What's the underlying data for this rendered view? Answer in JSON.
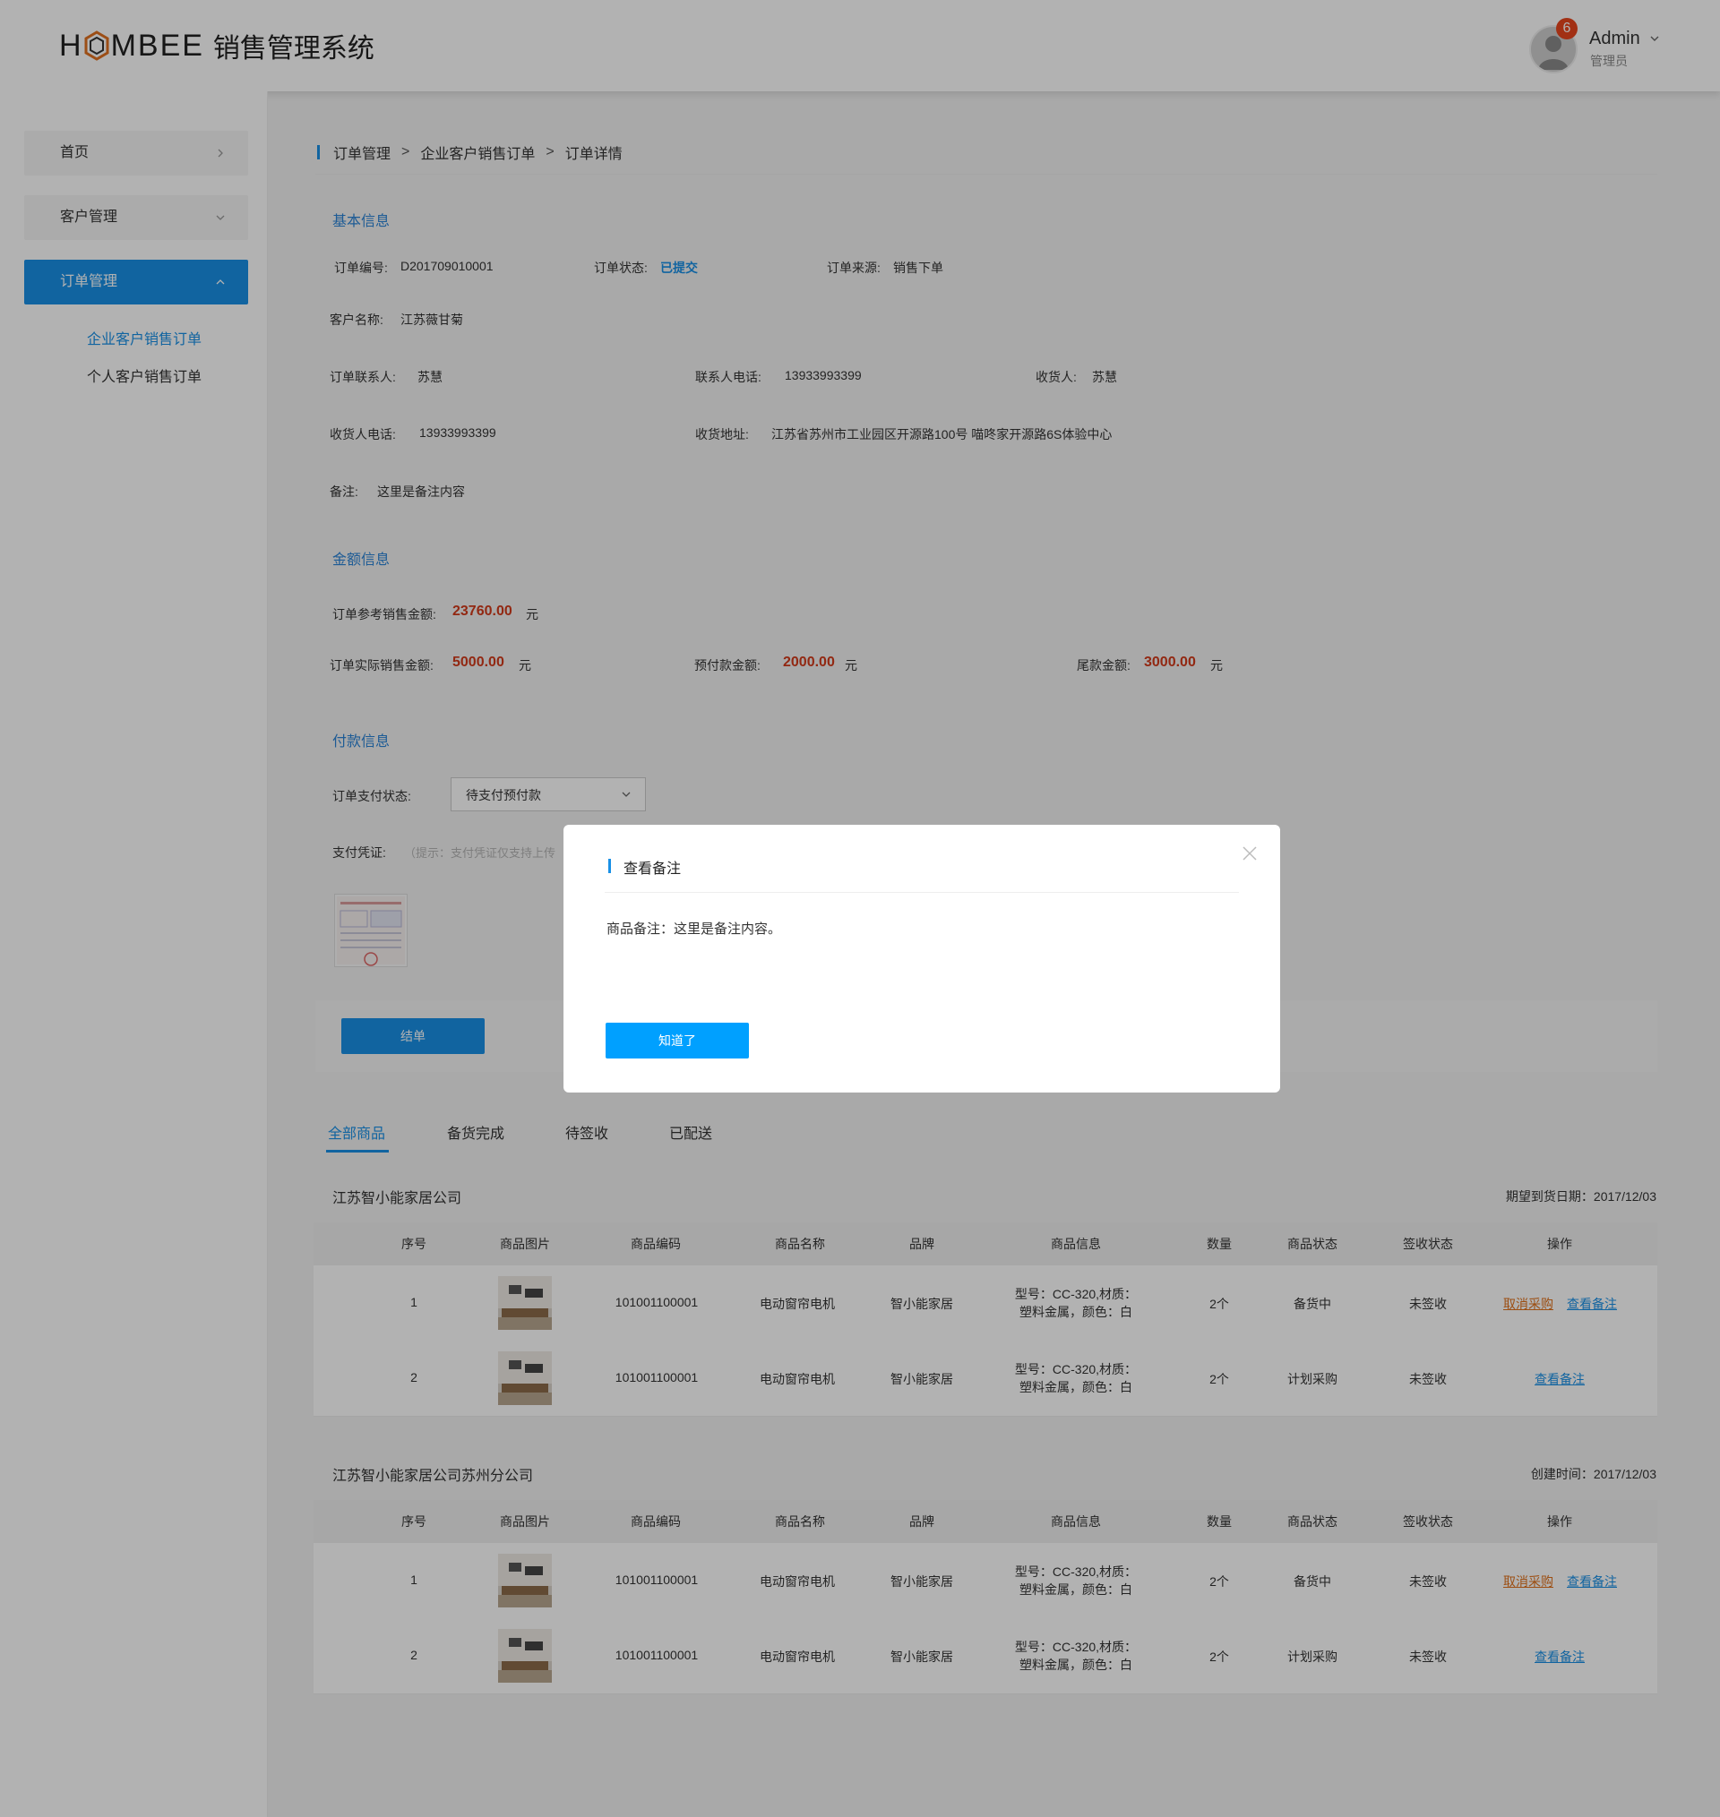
{
  "header": {
    "logo_text": "HOMBEE",
    "system_name": "销售管理系统",
    "notifications": "6",
    "user_name": "Admin",
    "user_role": "管理员"
  },
  "sidebar": {
    "items": [
      {
        "label": "首页",
        "icon": "chevron-right-icon"
      },
      {
        "label": "客户管理",
        "icon": "chevron-down-icon"
      },
      {
        "label": "订单管理",
        "icon": "chevron-up-icon",
        "active": true
      }
    ],
    "sub_items": [
      {
        "label": "企业客户销售订单",
        "active": true
      },
      {
        "label": "个人客户销售订单",
        "active": false
      }
    ]
  },
  "breadcrumb": [
    "订单管理",
    "企业客户销售订单",
    "订单详情"
  ],
  "basic": {
    "title": "基本信息",
    "order_no_label": "订单编号:",
    "order_no": "D201709010001",
    "status_label": "订单状态:",
    "status": "已提交",
    "source_label": "订单来源:",
    "source": "销售下单",
    "customer_label": "客户名称:",
    "customer": "江苏薇甘菊",
    "contact_label": "订单联系人:",
    "contact": "苏慧",
    "contact_phone_label": "联系人电话:",
    "contact_phone": "13933993399",
    "receiver_label": "收货人:",
    "receiver": "苏慧",
    "receiver_phone_label": "收货人电话:",
    "receiver_phone": "13933993399",
    "address_label": "收货地址:",
    "address": "江苏省苏州市工业园区开源路100号 喵咚家开源路6S体验中心",
    "remark_label": "备注:",
    "remark": "这里是备注内容"
  },
  "amount": {
    "title": "金额信息",
    "ref_label": "订单参考销售金额:",
    "ref": "23760.00",
    "actual_label": "订单实际销售金额:",
    "actual": "5000.00",
    "prepay_label": "预付款金额:",
    "prepay": "2000.00",
    "balance_label": "尾款金额:",
    "balance": "3000.00",
    "unit": "元"
  },
  "payment": {
    "title": "付款信息",
    "status_label": "订单支付状态:",
    "status_value": "待支付预付款",
    "voucher_label": "支付凭证:",
    "voucher_hint": "（提示：支付凭证仅支持上传"
  },
  "actions": {
    "settle": "结单"
  },
  "tabs": [
    "全部商品",
    "备货完成",
    "待签收",
    "已配送"
  ],
  "table_headers": [
    "序号",
    "商品图片",
    "商品编码",
    "商品名称",
    "品牌",
    "商品信息",
    "数量",
    "商品状态",
    "签收状态",
    "操作"
  ],
  "groups": [
    {
      "title": "江苏智小能家居公司",
      "date": "期望到货日期：2017/12/03",
      "rows": [
        {
          "no": "1",
          "code": "101001100001",
          "name": "电动窗帘电机",
          "brand": "智小能家居",
          "info1": "型号：CC-320,材质：",
          "info2": "塑料金属，颜色：白",
          "qty": "2个",
          "status": "备货中",
          "sign": "未签收",
          "op1": "取消采购",
          "op2": "查看备注"
        },
        {
          "no": "2",
          "code": "101001100001",
          "name": "电动窗帘电机",
          "brand": "智小能家居",
          "info1": "型号：CC-320,材质：",
          "info2": "塑料金属，颜色：白",
          "qty": "2个",
          "status": "计划采购",
          "sign": "未签收",
          "op1": "",
          "op2": "查看备注"
        }
      ]
    },
    {
      "title": "江苏智小能家居公司苏州分公司",
      "date": "创建时间：2017/12/03",
      "rows": [
        {
          "no": "1",
          "code": "101001100001",
          "name": "电动窗帘电机",
          "brand": "智小能家居",
          "info1": "型号：CC-320,材质：",
          "info2": "塑料金属，颜色：白",
          "qty": "2个",
          "status": "备货中",
          "sign": "未签收",
          "op1": "取消采购",
          "op2": "查看备注"
        },
        {
          "no": "2",
          "code": "101001100001",
          "name": "电动窗帘电机",
          "brand": "智小能家居",
          "info1": "型号：CC-320,材质：",
          "info2": "塑料金属，颜色：白",
          "qty": "2个",
          "status": "计划采购",
          "sign": "未签收",
          "op1": "",
          "op2": "查看备注"
        }
      ]
    }
  ],
  "modal": {
    "title": "查看备注",
    "content": "商品备注：这里是备注内容。",
    "ok": "知道了"
  },
  "colors": {
    "accent": "#1990e6",
    "money": "#d23a1a",
    "link_orange": "#e0701a",
    "badge": "#e8461e"
  }
}
